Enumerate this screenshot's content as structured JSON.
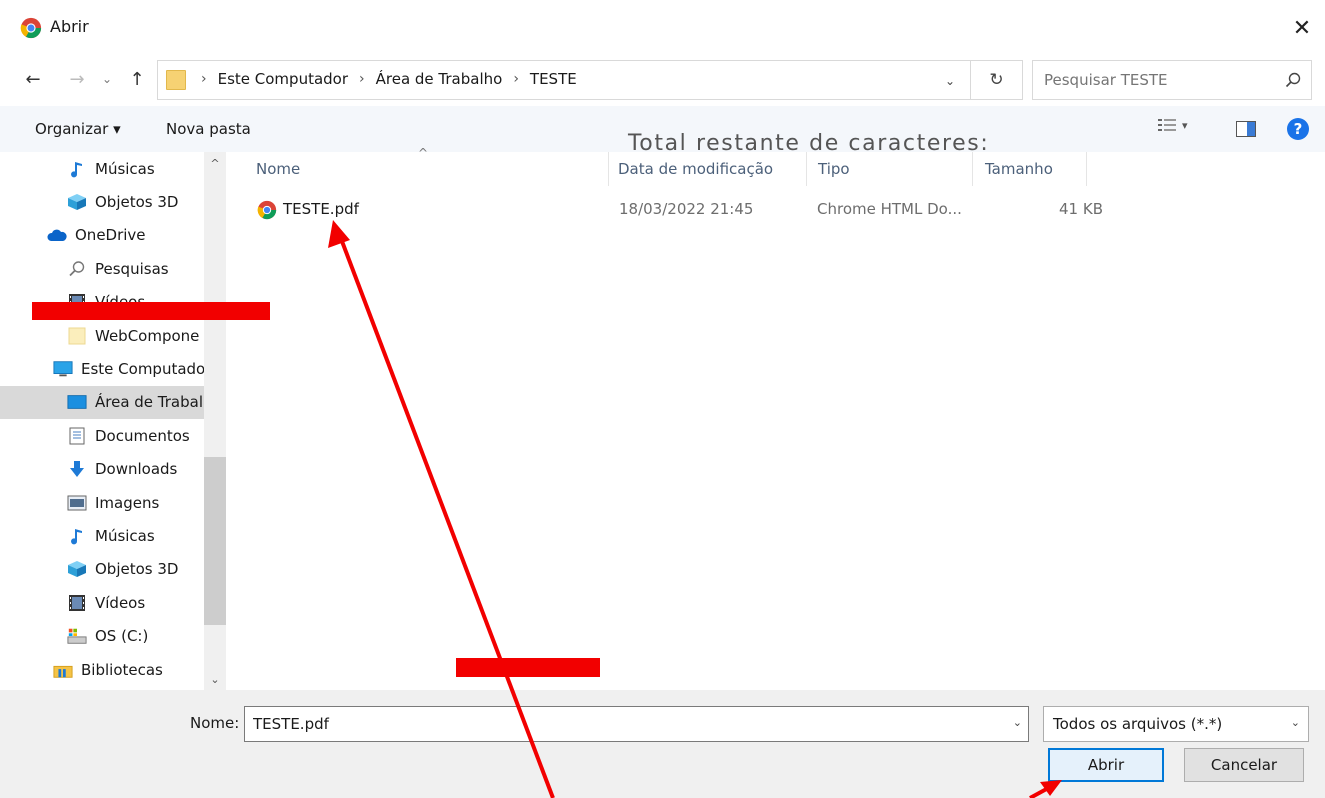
{
  "window": {
    "title": "Abrir",
    "title_icon": "chrome-icon",
    "close_label": "✕"
  },
  "address": {
    "crumbs": [
      "Este Computador",
      "Área de Trabalho",
      "TESTE"
    ],
    "search_placeholder": "Pesquisar TESTE"
  },
  "toolbar": {
    "organizar_label": "Organizar ▾",
    "nova_pasta_label": "Nova pasta",
    "overlay_text": "Total restante de caracteres:",
    "view_arrow": "▾",
    "help_label": "?"
  },
  "sidebar": {
    "items": [
      {
        "label": "Músicas",
        "icon": "music-icon"
      },
      {
        "label": "Objetos 3D",
        "icon": "cube-icon"
      },
      {
        "label": "OneDrive",
        "icon": "cloud-icon"
      },
      {
        "label": "Pesquisas",
        "icon": "search-icon"
      },
      {
        "label": "Vídeos",
        "icon": "film-icon"
      },
      {
        "label": "WebCompone",
        "icon": "folder-icon"
      },
      {
        "label": "Este Computado",
        "icon": "computer-icon"
      },
      {
        "label": "Área de Trabalh",
        "icon": "desktop-icon"
      },
      {
        "label": "Documentos",
        "icon": "document-icon"
      },
      {
        "label": "Downloads",
        "icon": "download-icon"
      },
      {
        "label": "Imagens",
        "icon": "image-icon"
      },
      {
        "label": "Músicas",
        "icon": "music-icon"
      },
      {
        "label": "Objetos 3D",
        "icon": "cube-icon"
      },
      {
        "label": "Vídeos",
        "icon": "film-icon"
      },
      {
        "label": "OS (C:)",
        "icon": "drive-icon"
      },
      {
        "label": "Bibliotecas",
        "icon": "library-icon"
      }
    ],
    "selected_index": 7
  },
  "filelist": {
    "columns": [
      "Nome",
      "Data de modificação",
      "Tipo",
      "Tamanho"
    ],
    "rows": [
      {
        "name": "TESTE.pdf",
        "date": "18/03/2022 21:45",
        "type": "Chrome HTML Do...",
        "size": "41 KB"
      }
    ]
  },
  "footer": {
    "name_label": "Nome:",
    "name_value": "TESTE.pdf",
    "filetype_value": "Todos os arquivos (*.*)",
    "open_label": "Abrir",
    "cancel_label": "Cancelar"
  },
  "colors": {
    "accent": "#0078d7",
    "annotation_red": "#f20000",
    "selected_bg": "#d9d9d9",
    "help_blue": "#1a73e8"
  }
}
